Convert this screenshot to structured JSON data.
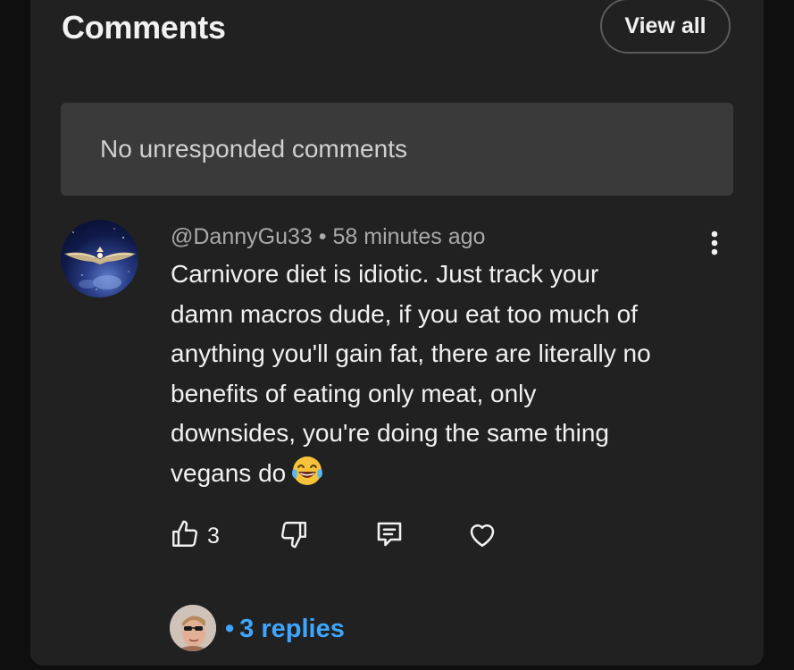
{
  "header": {
    "title": "Comments",
    "view_all_label": "View all"
  },
  "empty_state": {
    "text": "No unresponded comments"
  },
  "comment": {
    "author": "@DannyGu33",
    "separator": "•",
    "time": "58 minutes ago",
    "text_lines": [
      "Carnivore diet is idiotic. Just track your",
      "damn macros dude, if you eat too much of",
      "anything you'll gain fat, there are literally no",
      "benefits of eating only meat, only",
      "downsides, you're doing the same thing",
      "vegans do"
    ],
    "emoji": "face-with-tears-of-joy",
    "like_count": "3",
    "icons": {
      "more": "more-vertical-icon",
      "like": "thumbs-up-icon",
      "dislike": "thumbs-down-icon",
      "reply": "comment-icon",
      "heart": "heart-icon"
    }
  },
  "replies": {
    "separator": "•",
    "label": "3 replies"
  },
  "colors": {
    "background": "#0f0f0f",
    "card": "#212121",
    "empty_box": "#3a3a3a",
    "link": "#3ea6ff",
    "text": "#f1f1f1",
    "meta_text": "#aaaaaa"
  }
}
